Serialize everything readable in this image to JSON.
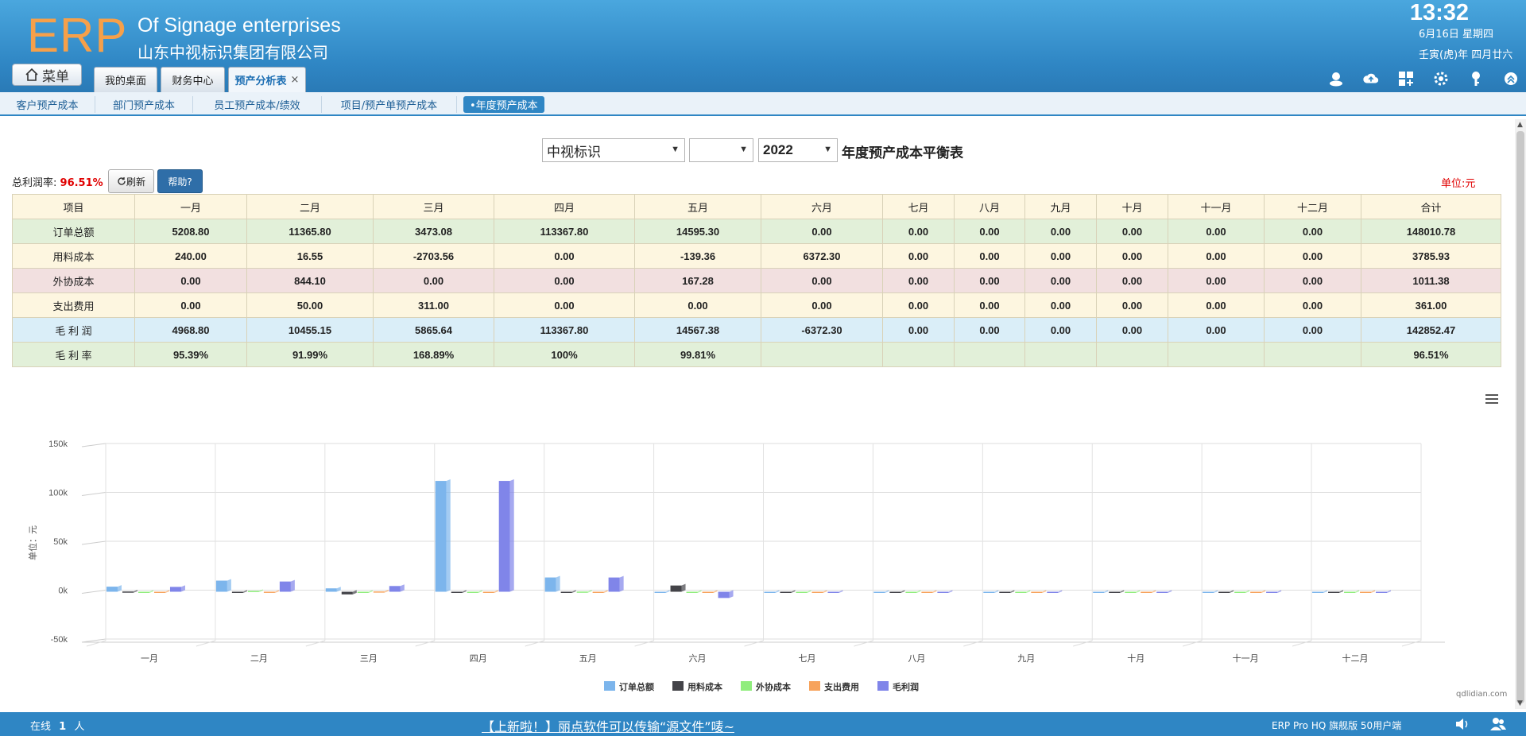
{
  "header": {
    "logo": "ERP",
    "company_en": "Of Signage enterprises",
    "company_cn": "山东中视标识集团有限公司",
    "time": "13:32",
    "date": "6月16日 星期四",
    "lunar": "壬寅(虎)年 四月廿六",
    "menu_label": "菜单",
    "tabs": [
      {
        "label": "我的桌面"
      },
      {
        "label": "财务中心"
      },
      {
        "label": "预产分析表",
        "close": "×"
      }
    ],
    "icons": [
      "user-icon",
      "cloud-upload-icon",
      "apps-icon",
      "settings-icon",
      "key-icon",
      "collapse-icon"
    ]
  },
  "subnav": {
    "items": [
      {
        "label": "客户预产成本"
      },
      {
        "label": "部门预产成本"
      },
      {
        "label": "员工预产成本/绩效"
      },
      {
        "label": "项目/预产单预产成本"
      },
      {
        "label": "•年度预产成本"
      }
    ]
  },
  "filters": {
    "company": "中视标识",
    "dept": "",
    "year": "2022",
    "title": "年度预产成本平衡表"
  },
  "summary": {
    "profit_label": "总利润率:",
    "profit_value": "96.51%",
    "refresh_label": "刷新",
    "help_label": "帮助?",
    "unit": "单位:元"
  },
  "table": {
    "headers": [
      "项目",
      "一月",
      "二月",
      "三月",
      "四月",
      "五月",
      "六月",
      "七月",
      "八月",
      "九月",
      "十月",
      "十一月",
      "十二月",
      "合计"
    ],
    "rows": [
      {
        "cells": [
          "订单总额",
          "5208.80",
          "11365.80",
          "3473.08",
          "113367.80",
          "14595.30",
          "0.00",
          "0.00",
          "0.00",
          "0.00",
          "0.00",
          "0.00",
          "0.00",
          "148010.78"
        ]
      },
      {
        "cells": [
          "用料成本",
          "240.00",
          "16.55",
          "-2703.56",
          "0.00",
          "-139.36",
          "6372.30",
          "0.00",
          "0.00",
          "0.00",
          "0.00",
          "0.00",
          "0.00",
          "3785.93"
        ]
      },
      {
        "cells": [
          "外协成本",
          "0.00",
          "844.10",
          "0.00",
          "0.00",
          "167.28",
          "0.00",
          "0.00",
          "0.00",
          "0.00",
          "0.00",
          "0.00",
          "0.00",
          "1011.38"
        ]
      },
      {
        "cells": [
          "支出费用",
          "0.00",
          "50.00",
          "311.00",
          "0.00",
          "0.00",
          "0.00",
          "0.00",
          "0.00",
          "0.00",
          "0.00",
          "0.00",
          "0.00",
          "361.00"
        ]
      },
      {
        "cells": [
          "毛 利 润",
          "4968.80",
          "10455.15",
          "5865.64",
          "113367.80",
          "14567.38",
          "-6372.30",
          "0.00",
          "0.00",
          "0.00",
          "0.00",
          "0.00",
          "0.00",
          "142852.47"
        ]
      },
      {
        "cells": [
          "毛 利 率",
          "95.39%",
          "91.99%",
          "168.89%",
          "100%",
          "99.81%",
          "",
          "",
          "",
          "",
          "",
          "",
          "",
          "96.51%"
        ]
      }
    ]
  },
  "chart_data": {
    "type": "bar",
    "categories": [
      "一月",
      "二月",
      "三月",
      "四月",
      "五月",
      "六月",
      "七月",
      "八月",
      "九月",
      "十月",
      "十一月",
      "十二月"
    ],
    "ylabel": "单位：元",
    "ylim": [
      -50000,
      150000
    ],
    "yticks": [
      "150k",
      "100k",
      "50k",
      "0k",
      "-50k"
    ],
    "ytick_values": [
      150000,
      100000,
      50000,
      0,
      -50000
    ],
    "legend_position": "bottom-center",
    "series": [
      {
        "name": "订单总额",
        "color": "#7cb5ec",
        "values": [
          5208.8,
          11365.8,
          3473.08,
          113367.8,
          14595.3,
          0,
          0,
          0,
          0,
          0,
          0,
          0
        ]
      },
      {
        "name": "用料成本",
        "color": "#434348",
        "values": [
          240.0,
          16.55,
          -2703.56,
          0,
          -139.36,
          6372.3,
          0,
          0,
          0,
          0,
          0,
          0
        ]
      },
      {
        "name": "外协成本",
        "color": "#90ed7d",
        "values": [
          0,
          844.1,
          0,
          0,
          167.28,
          0,
          0,
          0,
          0,
          0,
          0,
          0
        ]
      },
      {
        "name": "支出费用",
        "color": "#f7a35c",
        "values": [
          0,
          50.0,
          311.0,
          0,
          0,
          0,
          0,
          0,
          0,
          0,
          0,
          0
        ]
      },
      {
        "name": "毛利润",
        "color": "#8085e9",
        "values": [
          4968.8,
          10455.15,
          5865.64,
          113367.8,
          14567.38,
          -6372.3,
          0,
          0,
          0,
          0,
          0,
          0
        ]
      }
    ]
  },
  "watermark": "qdlidian.com",
  "footer": {
    "online_prefix": "在线",
    "online_count": "1",
    "online_suffix": "人",
    "marquee": "【上新啦！】丽点软件可以传输“源文件”唛~",
    "version": "ERP Pro HQ 旗舰版 50用户端"
  }
}
